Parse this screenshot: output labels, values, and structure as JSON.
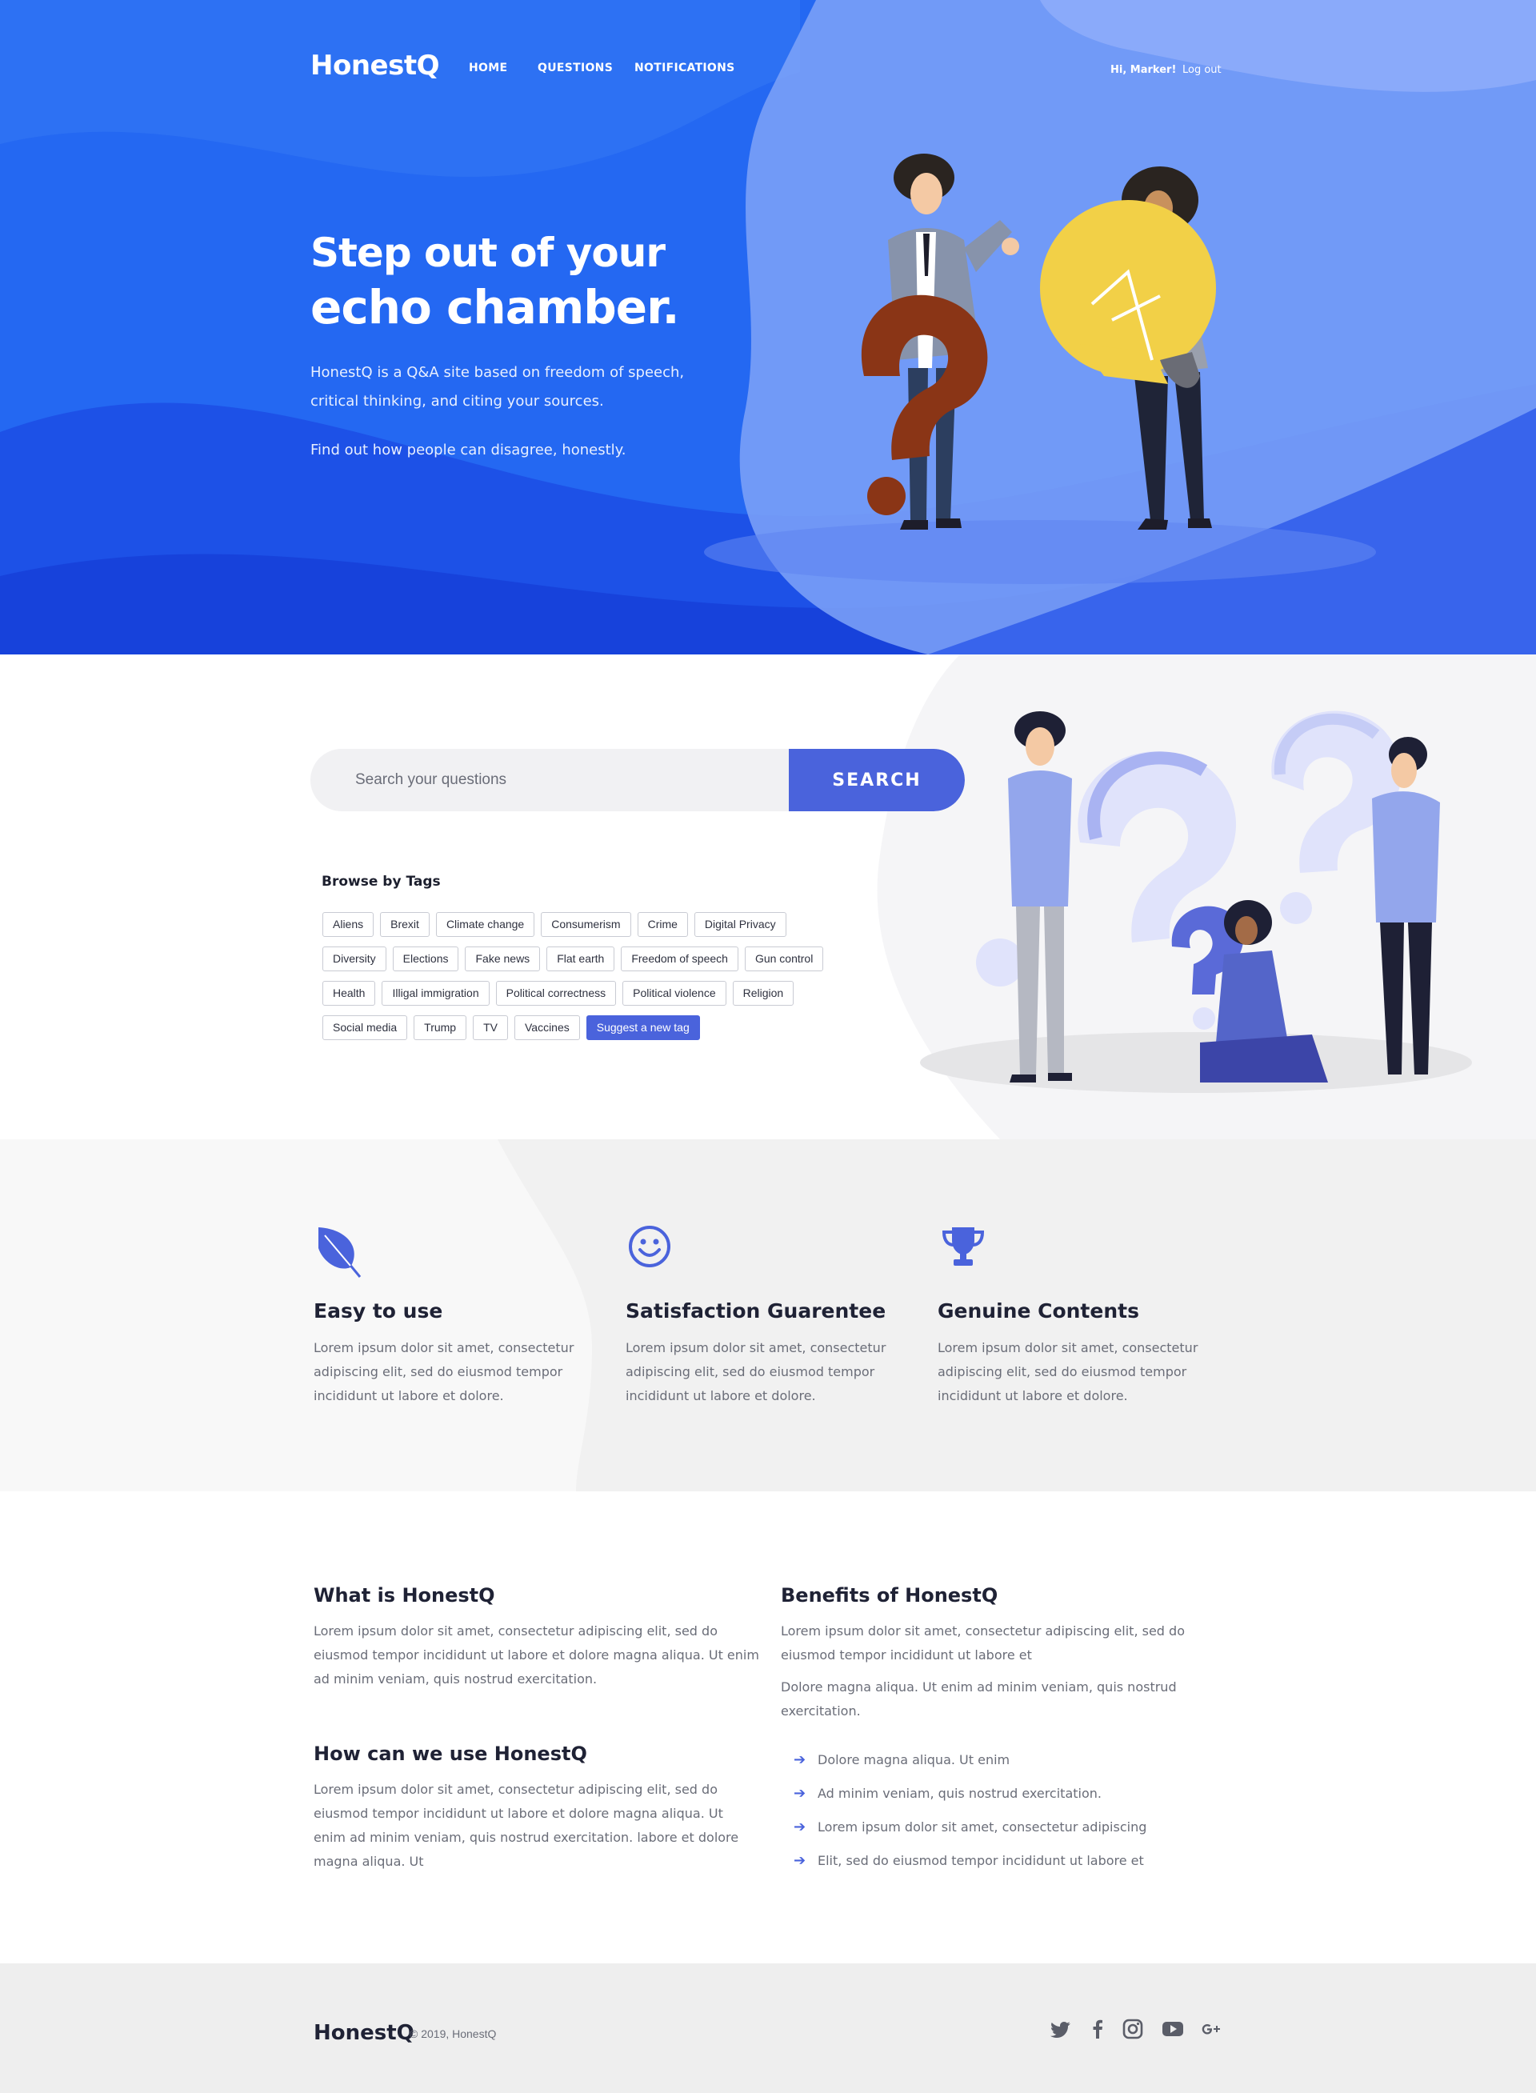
{
  "nav": {
    "logo": "HonestQ",
    "links": [
      "HOME",
      "QUESTIONS",
      "NOTIFICATIONS"
    ],
    "greeting": "Hi, Marker!",
    "logout": "Log out"
  },
  "hero": {
    "title_line1": "Step out of your",
    "title_line2": "echo chamber.",
    "description": "HonestQ is a Q&A site based on freedom of speech, critical thinking, and citing your sources.",
    "tagline": "Find out how people can disagree, honestly."
  },
  "search": {
    "placeholder": "Search your questions",
    "button": "SEARCH"
  },
  "tags": {
    "title": "Browse by Tags",
    "rows": [
      [
        "Aliens",
        "Brexit",
        "Climate change",
        "Consumerism",
        "Crime",
        "Digital Privacy"
      ],
      [
        "Diversity",
        "Elections",
        "Fake news",
        "Flat earth",
        "Freedom of speech",
        "Gun control"
      ],
      [
        "Health",
        "Illigal immigration",
        "Political correctness",
        "Political violence",
        "Religion"
      ],
      [
        "Social media",
        "Trump",
        "TV",
        "Vaccines"
      ]
    ],
    "suggest": "Suggest a new tag"
  },
  "features": [
    {
      "icon": "leaf-icon",
      "title": "Easy to use",
      "desc": "Lorem ipsum dolor sit amet, consectetur adipiscing elit, sed do eiusmod tempor incididunt ut labore et dolore."
    },
    {
      "icon": "smile-icon",
      "title": "Satisfaction Guarentee",
      "desc": "Lorem ipsum dolor sit amet, consectetur adipiscing elit, sed do eiusmod tempor incididunt ut labore et dolore."
    },
    {
      "icon": "trophy-icon",
      "title": "Genuine Contents",
      "desc": "Lorem ipsum dolor sit amet, consectetur adipiscing elit, sed do eiusmod tempor incididunt ut labore et dolore."
    }
  ],
  "info": {
    "what_title": "What is HonestQ",
    "what_text": "Lorem ipsum dolor sit amet, consectetur adipiscing elit, sed do eiusmod tempor incididunt ut labore et dolore magna aliqua. Ut enim ad minim veniam, quis nostrud exercitation.",
    "how_title": "How can we use HonestQ",
    "how_text": "Lorem ipsum dolor sit amet, consectetur adipiscing elit, sed do eiusmod tempor incididunt ut labore et dolore magna aliqua. Ut enim ad minim veniam, quis nostrud exercitation. labore et dolore magna aliqua. Ut",
    "benefits_title": "Benefits of HonestQ",
    "benefits_text1": "Lorem ipsum dolor sit amet, consectetur adipiscing elit, sed do eiusmod tempor incididunt ut labore et",
    "benefits_text2": "Dolore magna aliqua. Ut enim ad minim veniam, quis nostrud exercitation.",
    "benefits_list": [
      "Dolore magna aliqua. Ut enim",
      "Ad minim veniam, quis nostrud exercitation.",
      "Lorem ipsum dolor sit amet, consectetur adipiscing",
      "Elit, sed do eiusmod tempor incididunt ut labore et"
    ]
  },
  "footer": {
    "logo": "HonestQ",
    "copyright": "© 2019, HonestQ",
    "social": [
      "twitter-icon",
      "facebook-icon",
      "instagram-icon",
      "youtube-icon",
      "google-plus-icon"
    ]
  },
  "colors": {
    "primary": "#4a63dc",
    "hero_blue": "#1f5cf0",
    "heading": "#1f2235",
    "body_text": "#6a6d78"
  }
}
